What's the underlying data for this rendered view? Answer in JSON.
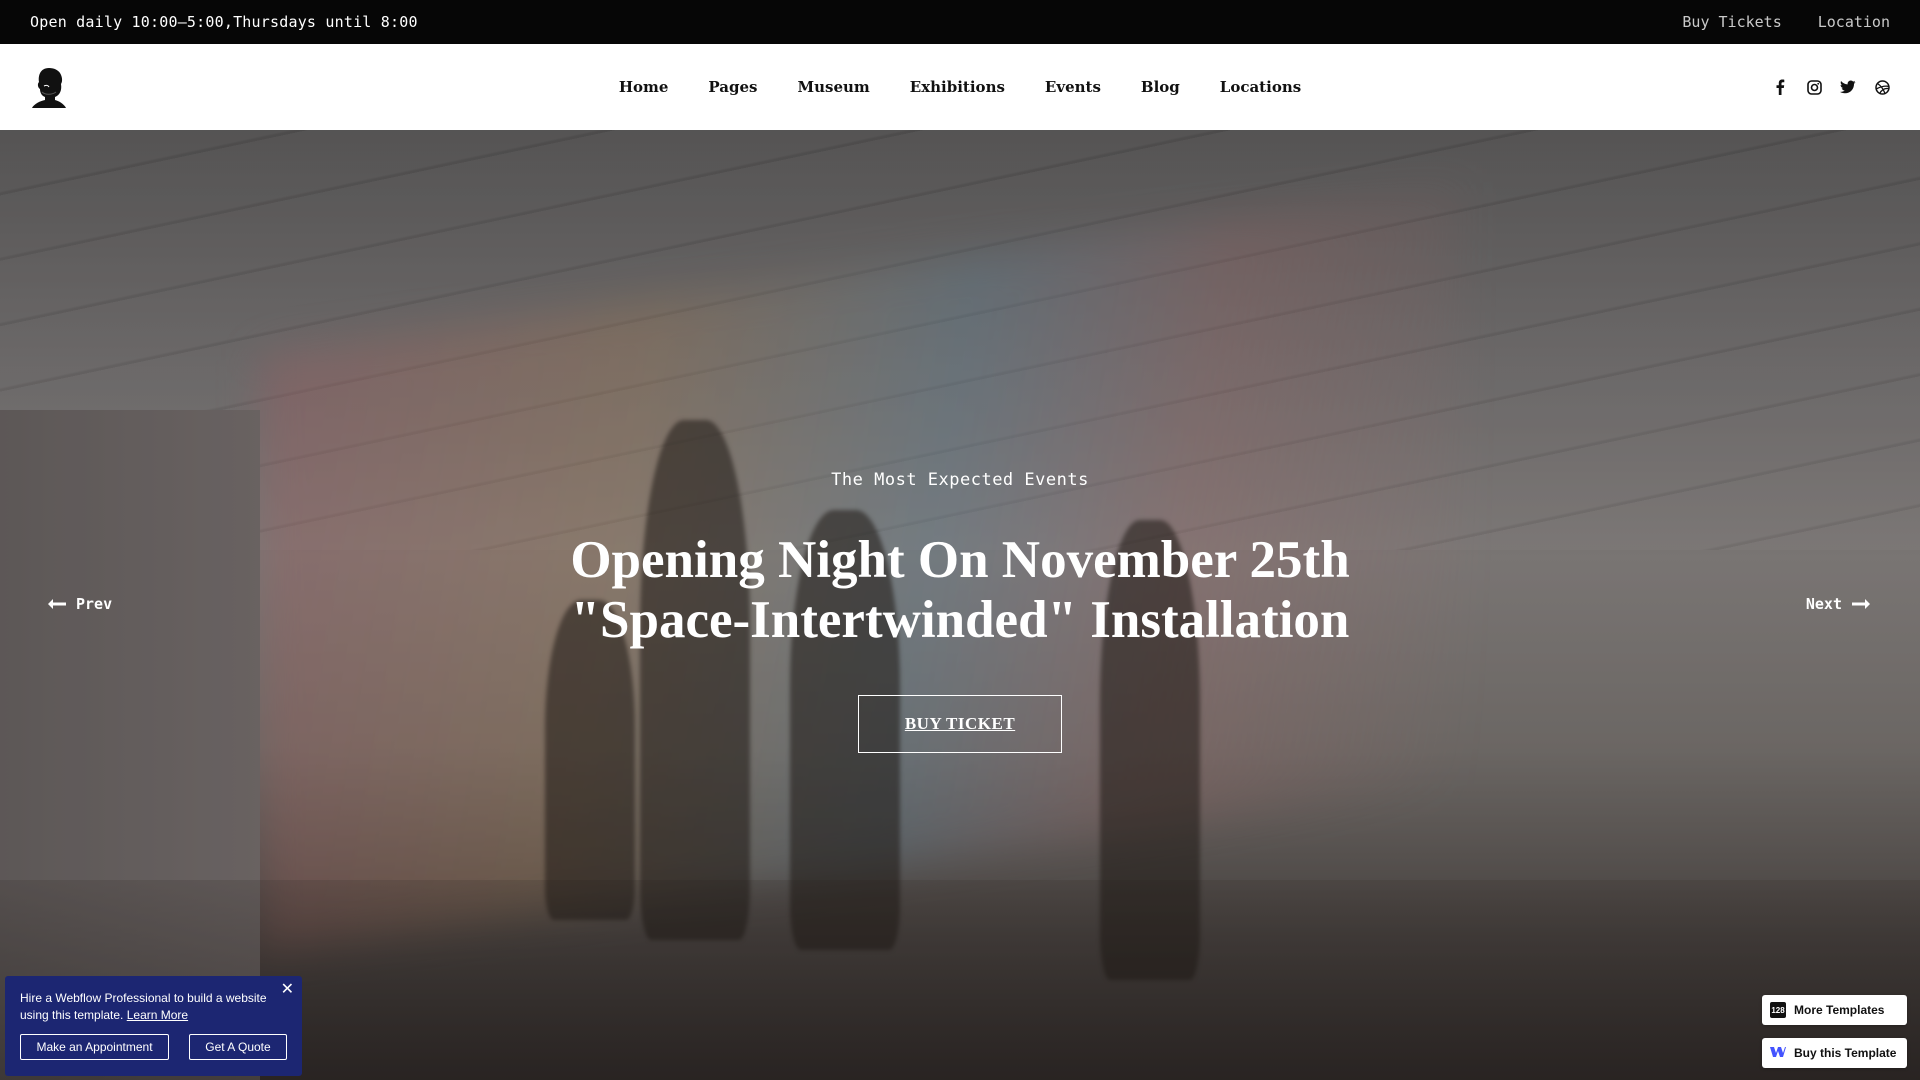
{
  "topbar": {
    "hours": "Open daily 10:00–5:00,Thursdays until 8:00",
    "links": [
      "Buy Tickets",
      "Location"
    ]
  },
  "nav": {
    "items": [
      "Home",
      "Pages",
      "Museum",
      "Exhibitions",
      "Events",
      "Blog",
      "Locations"
    ],
    "social_icons": [
      "facebook-icon",
      "instagram-icon",
      "twitter-icon",
      "dribbble-icon"
    ]
  },
  "hero": {
    "subtitle": "The Most Expected Events",
    "title_line1": "Opening Night On November 25th",
    "title_line2": "\"Space-Intertwinded\" Installation",
    "cta": "BUY TICKET",
    "prev": "Prev",
    "next": "Next"
  },
  "popup": {
    "text": "Hire a Webflow Professional to build a website using this template.",
    "learn_more": "Learn More",
    "appointment": "Make an Appointment",
    "quote": "Get A Quote"
  },
  "badges": {
    "more_templates": "More Templates",
    "more_icon": "128",
    "buy_template": "Buy this Template"
  },
  "colors": {
    "topbar_bg": "#060606",
    "popup_bg": "#1c2672",
    "webflow_blue": "#4353ff"
  }
}
